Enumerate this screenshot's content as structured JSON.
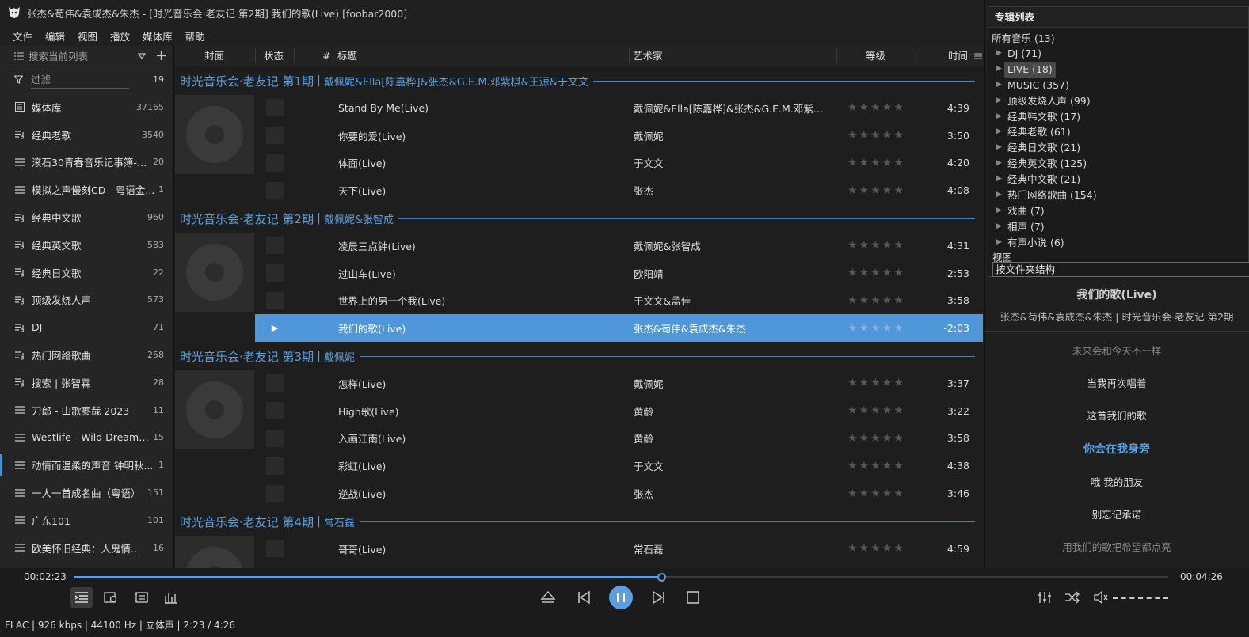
{
  "window": {
    "title": "张杰&苟伟&袁成杰&朱杰 - [时光音乐会·老友记 第2期] 我们的歌(Live)  [foobar2000]"
  },
  "menu": [
    "文件",
    "编辑",
    "视图",
    "播放",
    "媒体库",
    "帮助"
  ],
  "sidebar": {
    "search_placeholder": "搜索当前列表",
    "filter_label": "过滤",
    "filter_count": "19",
    "items": [
      {
        "name": "媒体库",
        "count": "37165",
        "icon": "library"
      },
      {
        "name": "经典老歌",
        "count": "3540",
        "icon": "autoplaylist"
      },
      {
        "name": "滚石30青春音乐记事簿-2...",
        "count": "20",
        "icon": "playlist"
      },
      {
        "name": "模拟之声慢刻CD - 粤语金...",
        "count": "1",
        "icon": "playlist"
      },
      {
        "name": "经典中文歌",
        "count": "960",
        "icon": "autoplaylist"
      },
      {
        "name": "经典英文歌",
        "count": "583",
        "icon": "autoplaylist"
      },
      {
        "name": "经典日文歌",
        "count": "22",
        "icon": "autoplaylist"
      },
      {
        "name": "顶级发烧人声",
        "count": "573",
        "icon": "autoplaylist"
      },
      {
        "name": "DJ",
        "count": "71",
        "icon": "autoplaylist"
      },
      {
        "name": "热门网络歌曲",
        "count": "258",
        "icon": "autoplaylist"
      },
      {
        "name": "搜索 | 张智霖",
        "count": "28",
        "icon": "autoplaylist"
      },
      {
        "name": "刀郎 - 山歌寥哉 2023",
        "count": "11",
        "icon": "playlist"
      },
      {
        "name": "Westlife - Wild Dreams ...",
        "count": "15",
        "icon": "playlist"
      },
      {
        "name": "动情而温柔的声音 钟明秋...",
        "count": "1",
        "icon": "playlist",
        "active": true
      },
      {
        "name": "一人一首成名曲（粤语）",
        "count": "151",
        "icon": "playlist"
      },
      {
        "name": "广东101",
        "count": "101",
        "icon": "playlist"
      },
      {
        "name": "欧美怀旧经典：人鬼情未...",
        "count": "16",
        "icon": "playlist"
      }
    ]
  },
  "columns": {
    "cover": "封面",
    "status": "状态",
    "number": "#",
    "title": "标题",
    "artist": "艺术家",
    "rating": "等级",
    "time": "时间"
  },
  "groups": [
    {
      "title": "时光音乐会·老友记 第1期",
      "artist": "戴佩妮&Ella[陈嘉桦]&张杰&G.E.M.邓紫棋&王源&于文文"
    },
    {
      "title": "时光音乐会·老友记 第2期",
      "artist": "戴佩妮&张智成"
    },
    {
      "title": "时光音乐会·老友记 第3期",
      "artist": "戴佩妮"
    },
    {
      "title": "时光音乐会·老友记 第4期",
      "artist": "常石磊"
    }
  ],
  "group_separator": "|",
  "tracks": [
    {
      "title": "Stand By Me(Live)",
      "artist": "戴佩妮&Ella[陈嘉桦]&张杰&G.E.M.邓紫棋&...",
      "time": "4:39"
    },
    {
      "title": "你要的爱(Live)",
      "artist": "戴佩妮",
      "time": "3:50"
    },
    {
      "title": "体面(Live)",
      "artist": "于文文",
      "time": "4:20"
    },
    {
      "title": "天下(Live)",
      "artist": "张杰",
      "time": "4:08"
    },
    {
      "title": "凌晨三点钟(Live)",
      "artist": "戴佩妮&张智成",
      "time": "4:31"
    },
    {
      "title": "过山车(Live)",
      "artist": "欧阳靖",
      "time": "2:53"
    },
    {
      "title": "世界上的另一个我(Live)",
      "artist": "于文文&孟佳",
      "time": "3:58"
    },
    {
      "title": "我们的歌(Live)",
      "artist": "张杰&苟伟&袁成杰&朱杰",
      "time": "-2:03",
      "playing": true
    },
    {
      "title": "怎样(Live)",
      "artist": "戴佩妮",
      "time": "3:37"
    },
    {
      "title": "High歌(Live)",
      "artist": "黄龄",
      "time": "3:22"
    },
    {
      "title": "入画江南(Live)",
      "artist": "黄龄",
      "time": "3:58"
    },
    {
      "title": "彩虹(Live)",
      "artist": "于文文",
      "time": "4:38"
    },
    {
      "title": "逆战(Live)",
      "artist": "张杰",
      "time": "3:46"
    },
    {
      "title": "哥哥(Live)",
      "artist": "常石磊",
      "time": "4:59"
    }
  ],
  "album_list": {
    "title": "专辑列表",
    "root": "所有音乐 (13)",
    "nodes": [
      {
        "label": "DJ (71)"
      },
      {
        "label": "LIVE (18)",
        "selected": true
      },
      {
        "label": "MUSIC (357)"
      },
      {
        "label": "顶级发烧人声 (99)"
      },
      {
        "label": "经典韩文歌 (17)"
      },
      {
        "label": "经典老歌 (61)"
      },
      {
        "label": "经典日文歌 (21)"
      },
      {
        "label": "经典英文歌 (125)"
      },
      {
        "label": "经典中文歌 (21)"
      },
      {
        "label": "热门网络歌曲 (154)"
      },
      {
        "label": "戏曲 (7)"
      },
      {
        "label": "相声 (7)"
      },
      {
        "label": "有声小说 (6)"
      }
    ],
    "view_label": "视图",
    "view_value": "按文件夹结构"
  },
  "now_playing": {
    "title": "我们的歌(Live)",
    "subtitle": "张杰&苟伟&袁成杰&朱杰  |  时光音乐会·老友记 第2期"
  },
  "lyrics": [
    {
      "text": "未来会和今天不一样",
      "state": "dim"
    },
    {
      "text": "当我再次唱着",
      "state": "normal"
    },
    {
      "text": "这首我们的歌",
      "state": "normal"
    },
    {
      "text": "你会在我身旁",
      "state": "current"
    },
    {
      "text": "哦 我的朋友",
      "state": "normal"
    },
    {
      "text": "别忘记承诺",
      "state": "normal"
    },
    {
      "text": "用我们的歌把希望都点亮",
      "state": "dim"
    }
  ],
  "playback": {
    "elapsed": "00:02:23",
    "total": "00:04:26",
    "progress": 0.537,
    "status_line": "FLAC | 926 kbps | 44100 Hz | 立体声 | 2:23 / 4:26"
  },
  "colors": {
    "accent": "#5aa0e0",
    "playing_row": "#4f97d8"
  }
}
